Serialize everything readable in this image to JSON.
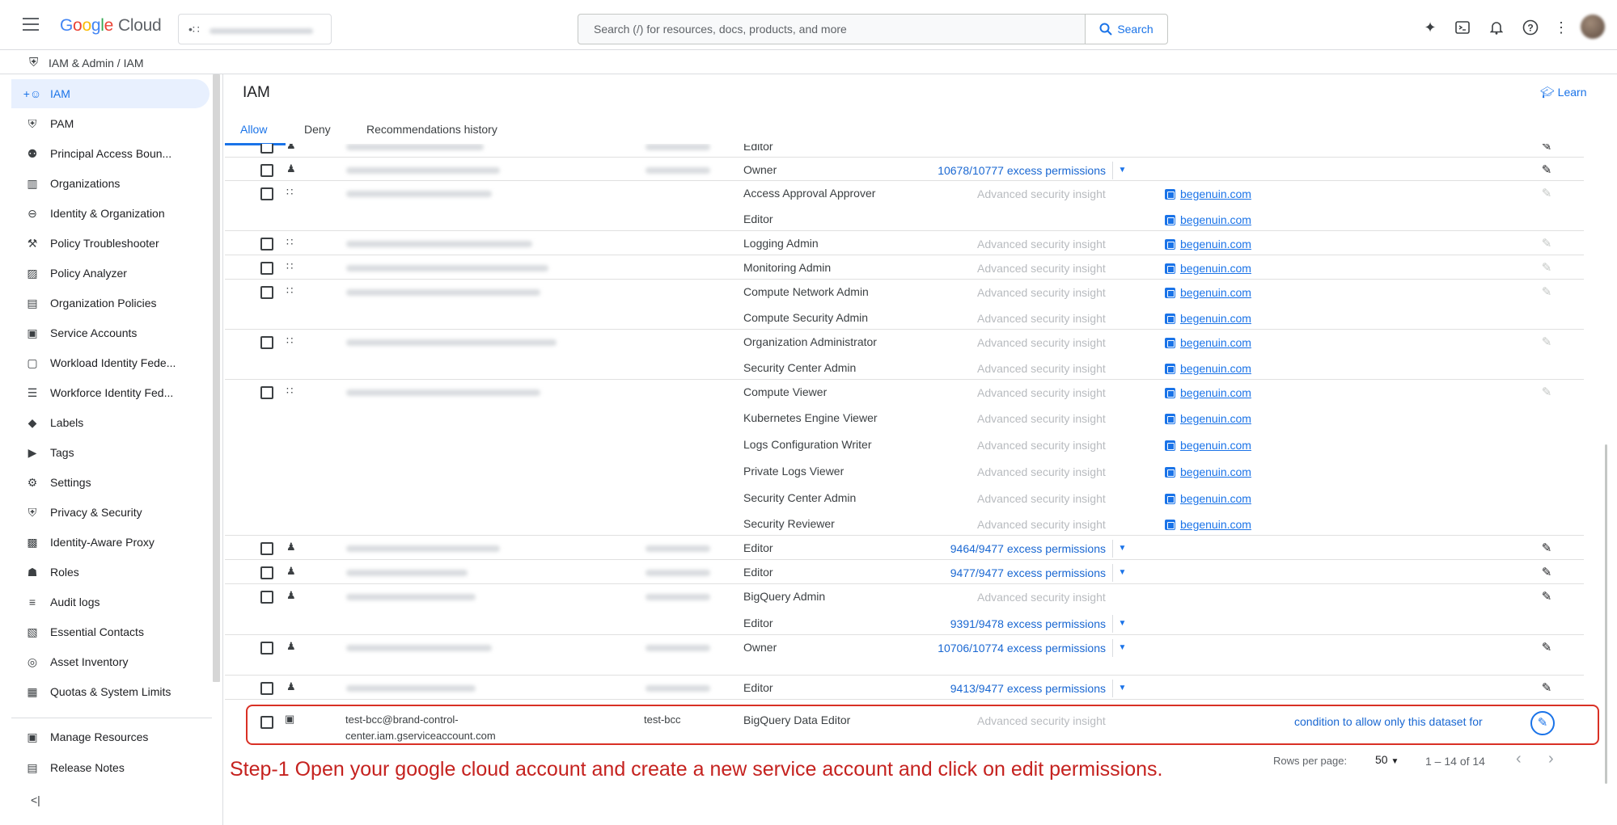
{
  "header": {
    "brand": "Google Cloud",
    "search_placeholder": "Search (/) for resources, docs, products, and more",
    "search_button": "Search"
  },
  "breadcrumb": "IAM & Admin  /  IAM",
  "sidebar": {
    "items": [
      {
        "label": "IAM",
        "icon": "person-add-icon",
        "glyph": "+☺"
      },
      {
        "label": "PAM",
        "icon": "shield-icon",
        "glyph": "⛨"
      },
      {
        "label": "Principal Access Boun...",
        "icon": "search-policy-icon",
        "glyph": "⚉"
      },
      {
        "label": "Organizations",
        "icon": "building-icon",
        "glyph": "▥"
      },
      {
        "label": "Identity & Organization",
        "icon": "account-circle-icon",
        "glyph": "⊖"
      },
      {
        "label": "Policy Troubleshooter",
        "icon": "wrench-icon",
        "glyph": "⚒"
      },
      {
        "label": "Policy Analyzer",
        "icon": "policy-analyzer-icon",
        "glyph": "▨"
      },
      {
        "label": "Organization Policies",
        "icon": "list-box-icon",
        "glyph": "▤"
      },
      {
        "label": "Service Accounts",
        "icon": "service-account-icon",
        "glyph": "▣"
      },
      {
        "label": "Workload Identity Fede...",
        "icon": "id-card-icon",
        "glyph": "▢"
      },
      {
        "label": "Workforce Identity Fed...",
        "icon": "list-icon",
        "glyph": "☰"
      },
      {
        "label": "Labels",
        "icon": "label-icon",
        "glyph": "◆"
      },
      {
        "label": "Tags",
        "icon": "tag-icon",
        "glyph": "▶"
      },
      {
        "label": "Settings",
        "icon": "gear-icon",
        "glyph": "⚙"
      },
      {
        "label": "Privacy & Security",
        "icon": "privacy-shield-icon",
        "glyph": "⛨"
      },
      {
        "label": "Identity-Aware Proxy",
        "icon": "proxy-icon",
        "glyph": "▩"
      },
      {
        "label": "Roles",
        "icon": "roles-icon",
        "glyph": "☗"
      },
      {
        "label": "Audit logs",
        "icon": "audit-logs-icon",
        "glyph": "≡"
      },
      {
        "label": "Essential Contacts",
        "icon": "contacts-icon",
        "glyph": "▧"
      },
      {
        "label": "Asset Inventory",
        "icon": "asset-inventory-icon",
        "glyph": "◎"
      },
      {
        "label": "Quotas & System Limits",
        "icon": "quotas-icon",
        "glyph": "▦"
      }
    ],
    "bottom_items": [
      {
        "label": "Manage Resources",
        "icon": "folder-icon",
        "glyph": "▣"
      },
      {
        "label": "Release Notes",
        "icon": "release-notes-icon",
        "glyph": "▤"
      }
    ],
    "collapse_label": "<|"
  },
  "main": {
    "title": "IAM",
    "learn": "Learn",
    "tabs": [
      "Allow",
      "Deny",
      "Recommendations history"
    ]
  },
  "table": {
    "rows": [
      {
        "role": "Editor",
        "edit": "dark"
      },
      {
        "role": "Owner",
        "excess": "10678/10777 excess permissions",
        "edit": "dark"
      },
      {
        "role": "Access Approval Approver",
        "insight": "Advanced security insight",
        "inherit": "begenuin.com",
        "edit": "light"
      },
      {
        "role": "Editor",
        "inherit": "begenuin.com"
      },
      {
        "role": "Logging Admin",
        "insight": "Advanced security insight",
        "inherit": "begenuin.com",
        "edit": "light"
      },
      {
        "role": "Monitoring Admin",
        "insight": "Advanced security insight",
        "inherit": "begenuin.com",
        "edit": "light"
      },
      {
        "role": "Compute Network Admin",
        "insight": "Advanced security insight",
        "inherit": "begenuin.com",
        "edit": "light"
      },
      {
        "role": "Compute Security Admin",
        "insight": "Advanced security insight",
        "inherit": "begenuin.com"
      },
      {
        "role": "Organization Administrator",
        "insight": "Advanced security insight",
        "inherit": "begenuin.com",
        "edit": "light"
      },
      {
        "role": "Security Center Admin",
        "insight": "Advanced security insight",
        "inherit": "begenuin.com"
      },
      {
        "role": "Compute Viewer",
        "insight": "Advanced security insight",
        "inherit": "begenuin.com",
        "edit": "light"
      },
      {
        "role": "Kubernetes Engine Viewer",
        "insight": "Advanced security insight",
        "inherit": "begenuin.com"
      },
      {
        "role": "Logs Configuration Writer",
        "insight": "Advanced security insight",
        "inherit": "begenuin.com"
      },
      {
        "role": "Private Logs Viewer",
        "insight": "Advanced security insight",
        "inherit": "begenuin.com"
      },
      {
        "role": "Security Center Admin",
        "insight": "Advanced security insight",
        "inherit": "begenuin.com"
      },
      {
        "role": "Security Reviewer",
        "insight": "Advanced security insight",
        "inherit": "begenuin.com"
      },
      {
        "role": "Editor",
        "excess": "9464/9477 excess permissions",
        "edit": "dark"
      },
      {
        "role": "Editor",
        "excess": "9477/9477 excess permissions",
        "edit": "dark"
      },
      {
        "role": "BigQuery Admin",
        "insight": "Advanced security insight",
        "edit": "dark"
      },
      {
        "role": "Editor",
        "excess": "9391/9478 excess permissions"
      },
      {
        "role": "Owner",
        "excess": "10706/10774 excess permissions",
        "edit": "dark"
      },
      {
        "role": "Editor",
        "excess": "9413/9477 excess permissions",
        "edit": "dark"
      }
    ],
    "highlighted": {
      "principal_line1": "test-bcc@brand-control-",
      "principal_line2": "center.iam.gserviceaccount.com",
      "name": "test-bcc",
      "role": "BigQuery Data Editor",
      "insight": "Advanced security insight",
      "condition": "condition to allow only this dataset for"
    }
  },
  "instruction": "Step-1 Open your google cloud account and create a new service account and click on edit permissions.",
  "pagination": {
    "rows_per_page_label": "Rows per page:",
    "rows_per_page": "50",
    "range": "1 – 14 of 14"
  }
}
